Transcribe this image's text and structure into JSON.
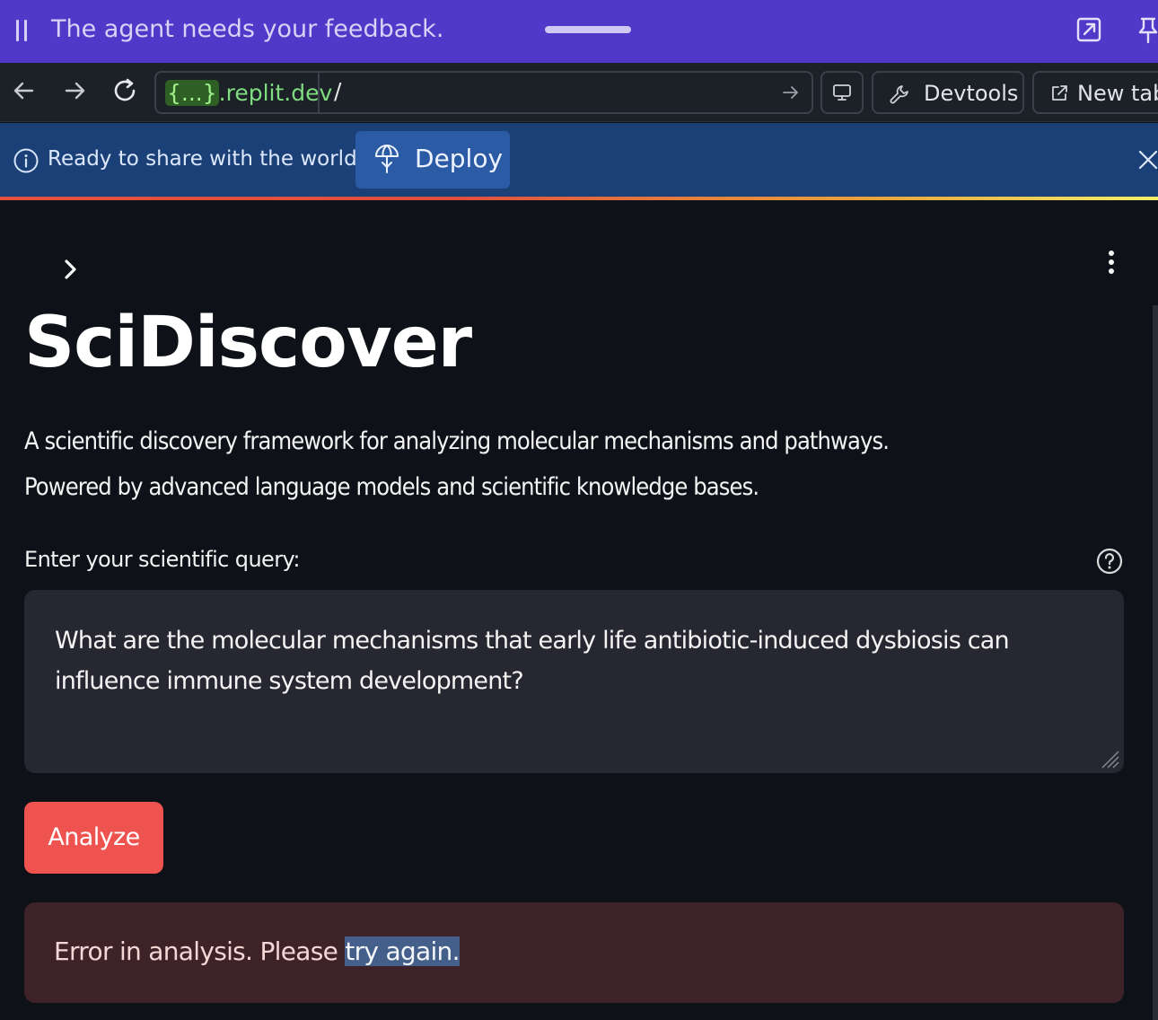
{
  "agent_bar": {
    "message": "The agent needs your feedback.",
    "icons": [
      "drag-grip-icon",
      "popout-icon",
      "pin-icon"
    ]
  },
  "browser": {
    "url_host_chip": "{...}",
    "url_host_rest": ".replit.dev",
    "url_path": "/",
    "devtools_label": "Devtools",
    "new_tab_label": "New tab",
    "icons": [
      "back-arrow-icon",
      "forward-arrow-icon",
      "reload-icon",
      "go-arrow-icon",
      "monitor-icon",
      "wrench-icon",
      "external-link-icon"
    ]
  },
  "banner": {
    "message": "Ready to share with the world?",
    "deploy_label": "Deploy",
    "colors": {
      "background": "#1b3f77",
      "button": "#2c5ba6"
    }
  },
  "app": {
    "title": "SciDiscover",
    "description_line1": "A scientific discovery framework for analyzing molecular mechanisms and pathways.",
    "description_line2": "Powered by advanced language models and scientific knowledge bases.",
    "query_label": "Enter your scientific query:",
    "query_value": "What are the molecular mechanisms that early life antibiotic-induced dysbiosis can influence immune system development?",
    "analyze_label": "Analyze",
    "error_prefix": "Error in analysis. Please ",
    "error_selected": "try again.",
    "colors": {
      "primary": "#ef5350",
      "error_bg": "#3d2328",
      "input_bg": "#262730",
      "page_bg": "#0e1117"
    }
  }
}
